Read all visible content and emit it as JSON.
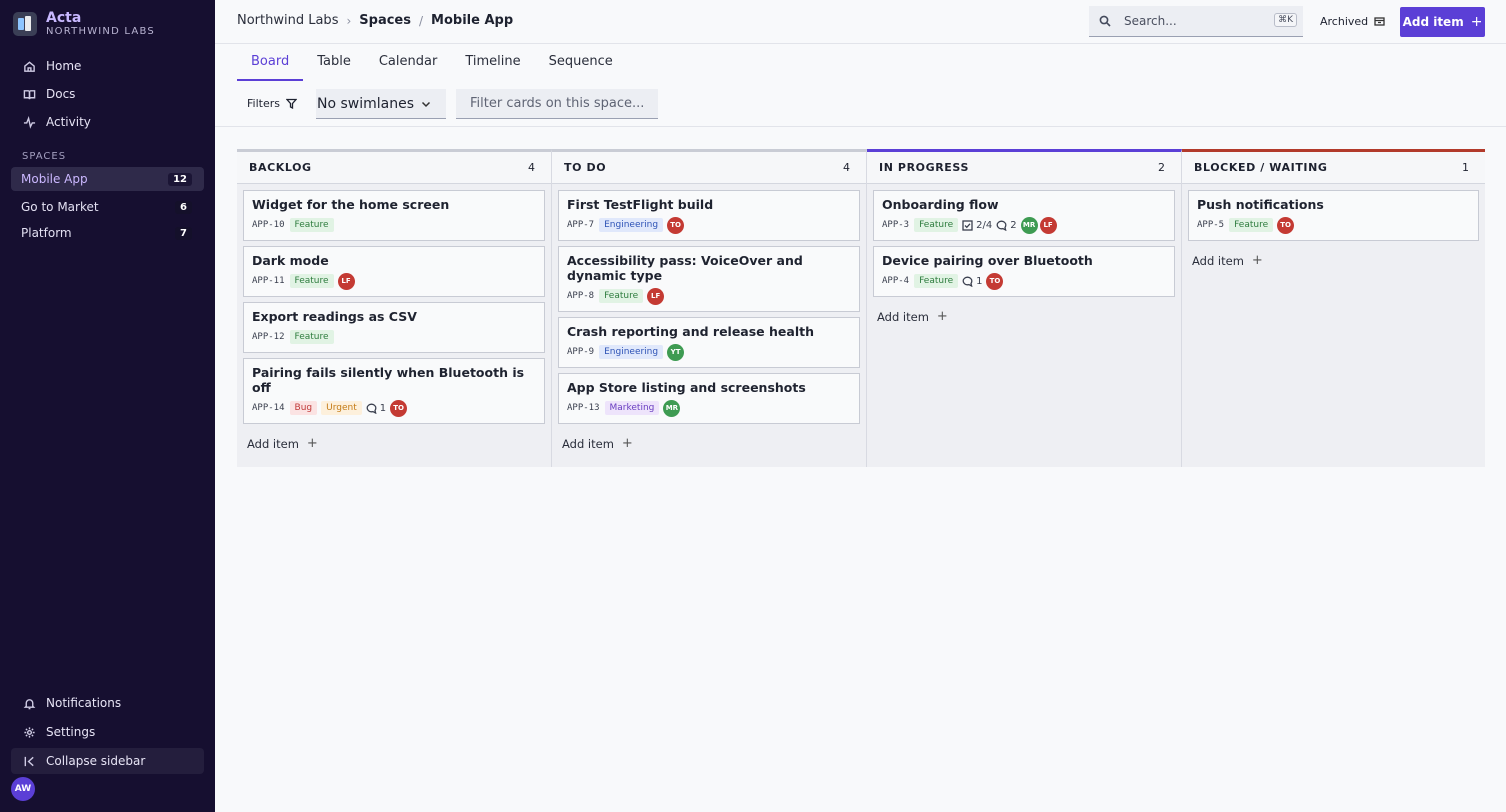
{
  "brand": {
    "name": "Acta",
    "org": "NORTHWIND LABS"
  },
  "nav": [
    {
      "label": "Home",
      "icon": "home-icon"
    },
    {
      "label": "Docs",
      "icon": "book-icon"
    },
    {
      "label": "Activity",
      "icon": "activity-icon"
    }
  ],
  "spaces": {
    "label": "SPACES",
    "items": [
      {
        "label": "Mobile App",
        "count": "12",
        "active": true
      },
      {
        "label": "Go to Market",
        "count": "6",
        "active": false
      },
      {
        "label": "Platform",
        "count": "7",
        "active": false
      }
    ]
  },
  "sidebar_bottom": {
    "notifications": "Notifications",
    "settings": "Settings",
    "collapse": "Collapse sidebar",
    "user_initials": "AW"
  },
  "header": {
    "breadcrumb": [
      "Northwind Labs",
      "Spaces",
      "Mobile App"
    ],
    "search_placeholder": "Search...",
    "search_shortcut": "⌘K",
    "archived": "Archived",
    "add_item": "Add item"
  },
  "tabs": [
    "Board",
    "Table",
    "Calendar",
    "Timeline",
    "Sequence"
  ],
  "toolbar": {
    "filters": "Filters",
    "swimlanes": "No swimlanes",
    "filter_placeholder": "Filter cards on this space..."
  },
  "columns": [
    {
      "title": "BACKLOG",
      "count": "4",
      "accent": "#c9ccd5",
      "cards": [
        {
          "title": "Widget for the home screen",
          "key": "APP-10",
          "tags": [
            "Feature"
          ]
        },
        {
          "title": "Dark mode",
          "key": "APP-11",
          "tags": [
            "Feature"
          ],
          "assignees": [
            "LF"
          ]
        },
        {
          "title": "Export readings as CSV",
          "key": "APP-12",
          "tags": [
            "Feature"
          ]
        },
        {
          "title": "Pairing fails silently when Bluetooth is off",
          "key": "APP-14",
          "tags": [
            "Bug",
            "Urgent"
          ],
          "comments": "1",
          "assignees": [
            "TO"
          ]
        }
      ]
    },
    {
      "title": "TO DO",
      "count": "4",
      "accent": "#c9ccd5",
      "cards": [
        {
          "title": "First TestFlight build",
          "key": "APP-7",
          "tags": [
            "Engineering"
          ],
          "assignees": [
            "TO"
          ]
        },
        {
          "title": "Accessibility pass: VoiceOver and dynamic type",
          "key": "APP-8",
          "tags": [
            "Feature"
          ],
          "assignees": [
            "LF"
          ]
        },
        {
          "title": "Crash reporting and release health",
          "key": "APP-9",
          "tags": [
            "Engineering"
          ],
          "assignees": [
            "YT"
          ]
        },
        {
          "title": "App Store listing and screenshots",
          "key": "APP-13",
          "tags": [
            "Marketing"
          ],
          "assignees": [
            "MR"
          ]
        }
      ]
    },
    {
      "title": "IN PROGRESS",
      "count": "2",
      "accent": "#5b3fd6",
      "cards": [
        {
          "title": "Onboarding flow",
          "key": "APP-3",
          "tags": [
            "Feature"
          ],
          "checklist": "2/4",
          "comments": "2",
          "assignees": [
            "MR",
            "LF"
          ]
        },
        {
          "title": "Device pairing over Bluetooth",
          "key": "APP-4",
          "tags": [
            "Feature"
          ],
          "comments": "1",
          "assignees": [
            "TO"
          ]
        }
      ]
    },
    {
      "title": "BLOCKED / WAITING",
      "count": "1",
      "accent": "#b23a2b",
      "cards": [
        {
          "title": "Push notifications",
          "key": "APP-5",
          "tags": [
            "Feature"
          ],
          "assignees": [
            "TO"
          ]
        }
      ]
    }
  ],
  "add_item_label": "Add item",
  "colors": {
    "accent": "#5b3fd6",
    "sidebar": "#160f30",
    "blocked": "#b23a2b"
  }
}
